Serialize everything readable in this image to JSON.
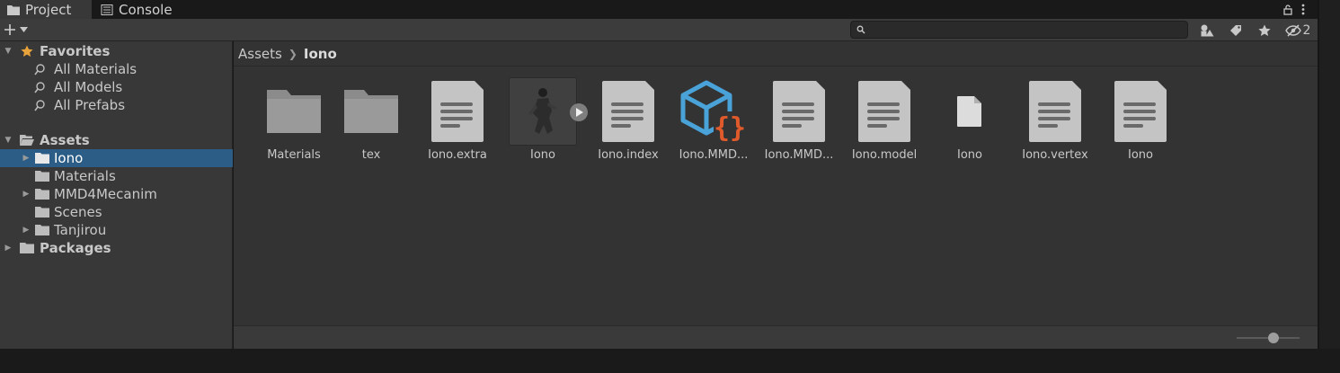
{
  "tabs": [
    {
      "label": "Project",
      "icon": "folder-icon"
    },
    {
      "label": "Console",
      "icon": "console-icon"
    }
  ],
  "toolbar": {
    "add_icon": "plus-icon",
    "search_placeholder": "",
    "hidden_count": "2"
  },
  "tree": {
    "favorites_label": "Favorites",
    "favorites": [
      "All Materials",
      "All Models",
      "All Prefabs"
    ],
    "assets_label": "Assets",
    "asset_items": [
      "Iono",
      "Materials",
      "MMD4Mecanim",
      "Scenes",
      "Tanjirou"
    ],
    "packages_label": "Packages"
  },
  "breadcrumb": {
    "root": "Assets",
    "current": "Iono"
  },
  "assets": [
    {
      "name": "Materials",
      "type": "folder"
    },
    {
      "name": "tex",
      "type": "folder"
    },
    {
      "name": "Iono.extra",
      "type": "text-file"
    },
    {
      "name": "Iono",
      "type": "model"
    },
    {
      "name": "Iono.index",
      "type": "text-file"
    },
    {
      "name": "Iono.MMD...",
      "type": "script-cube"
    },
    {
      "name": "Iono.MMD...",
      "type": "text-file"
    },
    {
      "name": "Iono.model",
      "type": "text-file"
    },
    {
      "name": "Iono",
      "type": "blank-file"
    },
    {
      "name": "Iono.vertex",
      "type": "text-file"
    },
    {
      "name": "Iono",
      "type": "text-file"
    }
  ],
  "colors": {
    "selection": "#2c5d87",
    "favorite_star": "#e8a33a",
    "cube_blue": "#4aa3d8",
    "braces_orange": "#e05a2b"
  }
}
